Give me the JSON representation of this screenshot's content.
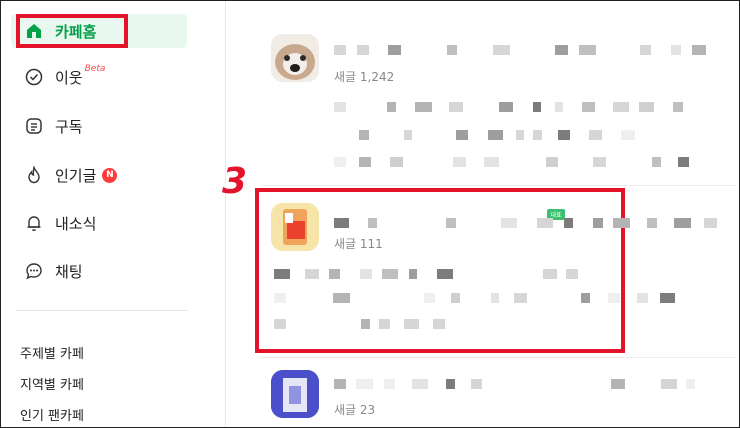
{
  "sidebar": {
    "items": [
      {
        "label": "카페홈",
        "icon": "home-icon"
      },
      {
        "label": "이웃",
        "icon": "check-circle-icon",
        "suffix": "Beta"
      },
      {
        "label": "구독",
        "icon": "subscribe-icon"
      },
      {
        "label": "인기글",
        "icon": "flame-icon",
        "badge": "N"
      },
      {
        "label": "내소식",
        "icon": "bell-icon"
      },
      {
        "label": "채팅",
        "icon": "chat-icon"
      }
    ],
    "categories": [
      "주제별 카페",
      "지역별 카페",
      "인기 팬카페"
    ]
  },
  "annotation": {
    "step": "3"
  },
  "feed": {
    "posts": [
      {
        "count": "새글 1,242"
      },
      {
        "count": "새글 111",
        "badge": "대표"
      },
      {
        "count": "새글 23"
      }
    ]
  },
  "colors": {
    "accent": "#03a14a",
    "highlight": "#e3132b",
    "badge": "#ff3b3b"
  }
}
